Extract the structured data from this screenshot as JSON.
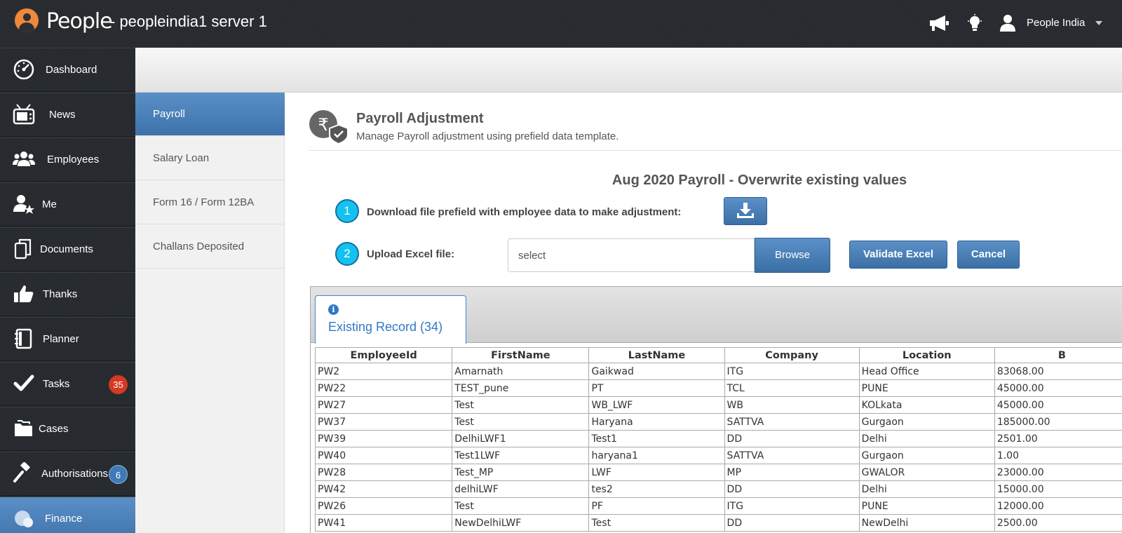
{
  "topbar": {
    "brand": "People",
    "server": "- peopleindia1 server 1",
    "user": "People India",
    "icons": [
      "megaphone-icon",
      "lightbulb-icon",
      "user-icon",
      "caret-down-icon"
    ]
  },
  "sidebar": {
    "items": [
      {
        "label": "Dashboard",
        "icon": "speedometer-icon"
      },
      {
        "label": "News",
        "icon": "tv-icon"
      },
      {
        "label": "Employees",
        "icon": "group-icon"
      },
      {
        "label": "Me",
        "icon": "user-star-icon"
      },
      {
        "label": "Documents",
        "icon": "documents-icon"
      },
      {
        "label": "Thanks",
        "icon": "thumbs-up-icon"
      },
      {
        "label": "Planner",
        "icon": "planner-icon"
      },
      {
        "label": "Tasks",
        "icon": "check-icon",
        "badge": "35"
      },
      {
        "label": "Cases",
        "icon": "folder-icon"
      },
      {
        "label": "Authorisations",
        "icon": "gavel-icon",
        "badge": "6"
      },
      {
        "label": "Finance",
        "icon": "rupee-icon"
      }
    ]
  },
  "subnav": {
    "items": [
      "Payroll",
      "Salary Loan",
      "Form 16 / Form 12BA",
      "Challans Deposited"
    ]
  },
  "content": {
    "title": "Payroll Adjustment",
    "subtitle": "Manage Payroll adjustment using prefield data template.",
    "period": "Aug 2020 Payroll - Overwrite existing values",
    "step1": {
      "num": "1",
      "label": "Download file prefield with employee data to make adjustment:"
    },
    "step2": {
      "num": "2",
      "label": "Upload Excel file:"
    },
    "file_value": "select",
    "browse": "Browse",
    "validate": "Validate Excel",
    "cancel": "Cancel"
  },
  "grid": {
    "tab": "Existing Record (34)",
    "columns": [
      "EmployeeId",
      "FirstName",
      "LastName",
      "Company",
      "Location",
      "B"
    ],
    "rows": [
      [
        "PW2",
        "Amarnath",
        "Gaikwad",
        "ITG",
        "Head Office",
        "83068.00"
      ],
      [
        "PW22",
        "TEST_pune",
        "PT",
        "TCL",
        "PUNE",
        "45000.00"
      ],
      [
        "PW27",
        "Test",
        "WB_LWF",
        "WB",
        "KOLkata",
        "45000.00"
      ],
      [
        "PW37",
        "Test",
        "Haryana",
        "SATTVA",
        "Gurgaon",
        "185000.00"
      ],
      [
        "PW39",
        "DelhiLWF1",
        "Test1",
        "DD",
        "Delhi",
        "2501.00"
      ],
      [
        "PW40",
        "Test1LWF",
        "haryana1",
        "SATTVA",
        "Gurgaon",
        "1.00"
      ],
      [
        "PW28",
        "Test_MP",
        "LWF",
        "MP",
        "GWALOR",
        "23000.00"
      ],
      [
        "PW42",
        "delhiLWF",
        "tes2",
        "DD",
        "Delhi",
        "15000.00"
      ],
      [
        "PW26",
        "Test",
        "PF",
        "ITG",
        "PUNE",
        "12000.00"
      ],
      [
        "PW41",
        "NewDelhiLWF",
        "Test",
        "DD",
        "NewDelhi",
        "2500.00"
      ]
    ]
  }
}
